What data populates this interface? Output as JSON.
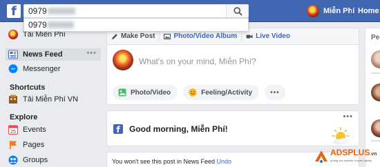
{
  "topbar": {
    "logo_letter": "f",
    "search_value": "0979",
    "profile_name": "Miễn Phí",
    "home_label": "Home"
  },
  "search_dropdown": {
    "suggestion": "0979"
  },
  "sidebar": {
    "user_name": "Tải Miễn Phí",
    "items": [
      {
        "label": "News Feed",
        "active": true,
        "icon": "news-feed-icon"
      },
      {
        "label": "Messenger",
        "icon": "messenger-icon"
      }
    ],
    "shortcuts_heading": "Shortcuts",
    "shortcuts": [
      {
        "label": "Tải Miễn Phí VN",
        "icon": "page-shortcut-icon"
      }
    ],
    "explore_heading": "Explore",
    "explore": [
      {
        "label": "Events",
        "icon": "calendar-icon"
      },
      {
        "label": "Pages",
        "icon": "flag-icon"
      },
      {
        "label": "Groups",
        "icon": "groups-icon"
      }
    ]
  },
  "composer": {
    "tabs": [
      "Make Post",
      "Photo/Video Album",
      "Live Video"
    ],
    "placeholder": "What's on your mind, Miễn Phí?",
    "actions": [
      "Photo/Video",
      "Feeling/Activity"
    ]
  },
  "greeting": {
    "text": "Good morning, Miễn Phí!"
  },
  "hidden_post": {
    "message": "You won't see this post in News Feed",
    "undo": "Undo"
  },
  "right_column": {
    "heading": "Peo"
  },
  "watermark": {
    "brand": "ADSPLUS",
    "tld": ".vn",
    "tagline": "quảng cáo website chuyên nghiệp"
  },
  "colors": {
    "brand_blue": "#4267b2",
    "background": "#e9ebee"
  }
}
